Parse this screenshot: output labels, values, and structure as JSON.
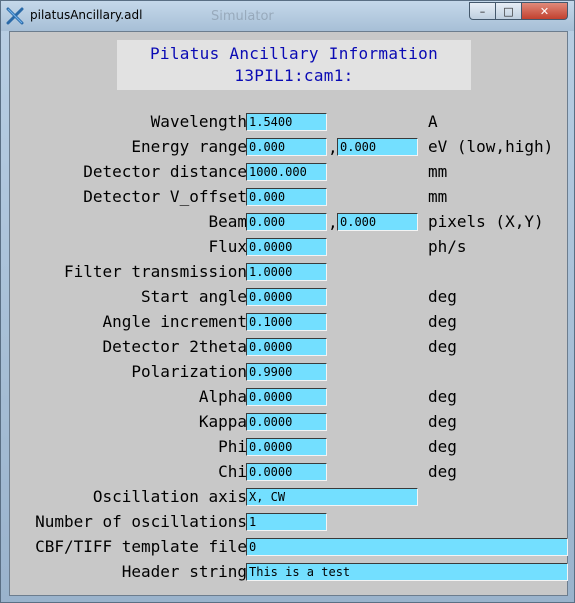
{
  "window": {
    "title": "pilatusAncillary.adl",
    "background_hint": "Simulator",
    "controls": {
      "minimize": "–",
      "maximize": "□",
      "close": "✕"
    }
  },
  "header": {
    "title": "Pilatus Ancillary Information",
    "prefix": "13PIL1:cam1:"
  },
  "rows": [
    {
      "label": "Wavelength",
      "value": "1.5400",
      "unit": "A"
    },
    {
      "label": "Energy range",
      "value": "0.000",
      "value2": "0.000",
      "separator": ",",
      "unit": "eV (low,high)"
    },
    {
      "label": "Detector distance",
      "value": "1000.000",
      "unit": "mm"
    },
    {
      "label": "Detector V_offset",
      "value": "0.000",
      "unit": "mm"
    },
    {
      "label": "Beam",
      "value": "0.000",
      "value2": "0.000",
      "separator": ",",
      "unit": "pixels (X,Y)"
    },
    {
      "label": "Flux",
      "value": "0.0000",
      "unit": "ph/s"
    },
    {
      "label": "Filter transmission",
      "value": "1.0000",
      "unit": ""
    },
    {
      "label": "Start angle",
      "value": "0.0000",
      "unit": "deg"
    },
    {
      "label": "Angle increment",
      "value": "0.1000",
      "unit": "deg"
    },
    {
      "label": "Detector 2theta",
      "value": "0.0000",
      "unit": "deg"
    },
    {
      "label": "Polarization",
      "value": "0.9900",
      "unit": ""
    },
    {
      "label": "Alpha",
      "value": "0.0000",
      "unit": "deg"
    },
    {
      "label": "Kappa",
      "value": "0.0000",
      "unit": "deg"
    },
    {
      "label": "Phi",
      "value": "0.0000",
      "unit": "deg"
    },
    {
      "label": "Chi",
      "value": "0.0000",
      "unit": "deg"
    },
    {
      "label": "Oscillation axis",
      "value": "X, CW",
      "unit": ""
    },
    {
      "label": "Number of oscillations",
      "value": "1",
      "unit": ""
    },
    {
      "label": "CBF/TIFF template file",
      "value": "0",
      "unit": ""
    },
    {
      "label": "Header string",
      "value": "This is a test",
      "unit": ""
    }
  ],
  "colors": {
    "field_bg": "#73dfff",
    "header_text": "#0a0ab4",
    "panel_bg": "#c8c8c8"
  }
}
